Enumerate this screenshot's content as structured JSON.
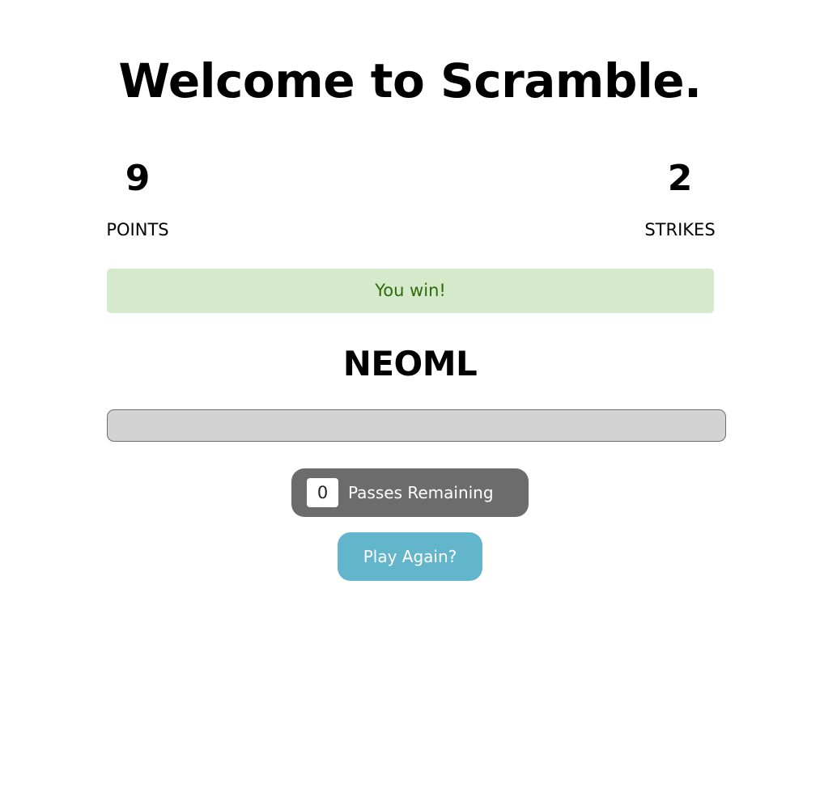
{
  "title": "Welcome to Scramble.",
  "stats": {
    "points": {
      "value": "9",
      "label": "POINTS"
    },
    "strikes": {
      "value": "2",
      "label": "STRIKES"
    }
  },
  "alert": {
    "message": "You win!",
    "background_color": "#d5eacb",
    "text_color": "#2e6b0b"
  },
  "scrambled_word": "NEOML",
  "guess_input": {
    "value": "",
    "placeholder": ""
  },
  "pass_button": {
    "count": "0",
    "label": "Passes Remaining",
    "color": "#6c6c6c"
  },
  "play_again_button": {
    "label": "Play Again?",
    "color": "#63b5cc"
  }
}
